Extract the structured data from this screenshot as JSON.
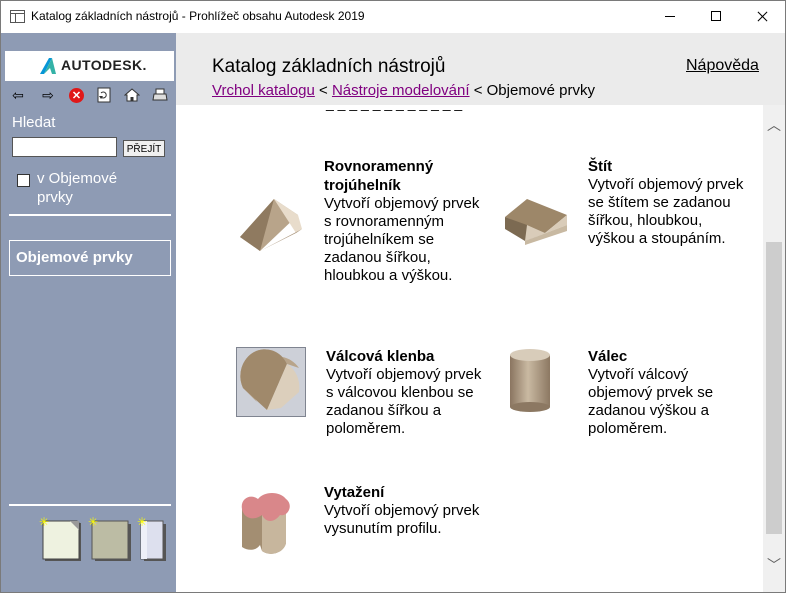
{
  "window": {
    "title": "Katalog základních nástrojů - Prohlížeč obsahu Autodesk 2019"
  },
  "sidebar": {
    "logo_text": "AUTODESK.",
    "nav_icons": [
      "back-arrow-icon",
      "forward-arrow-icon",
      "stop-icon",
      "refresh-icon",
      "home-icon",
      "print-icon"
    ],
    "search": {
      "label": "Hledat",
      "value": "",
      "button_label": "PŘEJÍT",
      "scope_label": "v Objemové prvky",
      "scope_checked": false
    },
    "current_category": "Objemové prvky"
  },
  "header": {
    "title": "Katalog základních nástrojů",
    "help_link": "Nápověda",
    "breadcrumb": {
      "items": [
        {
          "label": "Vrchol katalogu",
          "link": true
        },
        {
          "label": "Nástroje modelování",
          "link": true
        },
        {
          "label": "Objemové prvky",
          "link": false
        }
      ],
      "separator": "<"
    }
  },
  "tools": [
    {
      "title": "Rovnoramenný trojúhelník",
      "description": "Vytvoří objemový prvek s rovnoramenným trojúhelníkem se zadanou šířkou, hloubkou a výškou.",
      "icon": "isosceles-triangle-solid-icon"
    },
    {
      "title": "Štít",
      "description": "Vytvoří objemový prvek se štítem se zadanou šířkou, hloubkou, výškou a stoupáním.",
      "icon": "gable-solid-icon"
    },
    {
      "title": "Válcová klenba",
      "description": "Vytvoří objemový prvek s válcovou klenbou se zadanou šířkou a poloměrem.",
      "icon": "barrel-vault-solid-icon"
    },
    {
      "title": "Válec",
      "description": "Vytvoří válcový objemový prvek se zadanou výškou a poloměrem.",
      "icon": "cylinder-solid-icon"
    },
    {
      "title": "Vytažení",
      "description": "Vytvoří objemový prvek vysunutím profilu.",
      "icon": "extrusion-solid-icon"
    }
  ],
  "colors": {
    "sidebar_bg": "#8e9bb4",
    "header_bg": "#ebebeb",
    "link_visited": "#800080",
    "stop_red": "#e01818"
  }
}
